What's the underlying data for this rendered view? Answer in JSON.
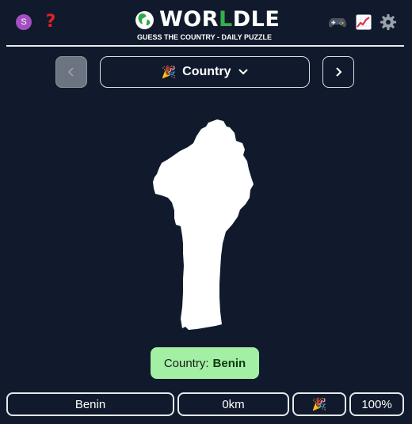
{
  "header": {
    "avatar_letter": "S",
    "help_glyph": "?",
    "logo_parts": [
      "WOR",
      "L",
      "DLE"
    ],
    "subtitle": "GUESS THE COUNTRY - DAILY PUZZLE",
    "icons": [
      "avatar-icon",
      "help-icon",
      "globe-icon",
      "gamepad-icon",
      "stats-chart-icon",
      "gear-icon"
    ]
  },
  "nav": {
    "prev_glyph": "‹",
    "next_glyph": "›",
    "mode_emoji": "🎉",
    "mode_label": "Country"
  },
  "answer": {
    "prefix": "Country:",
    "country": "Benin"
  },
  "guess": {
    "name": "Benin",
    "distance": "0km",
    "direction_emoji": "🎉",
    "proximity": "100%"
  },
  "colors": {
    "background": "#101a2c",
    "logo_accent": "#35b04a",
    "answer_bg": "#a3efa3",
    "avatar_bg": "#a44fc1",
    "help": "#e0202a"
  }
}
